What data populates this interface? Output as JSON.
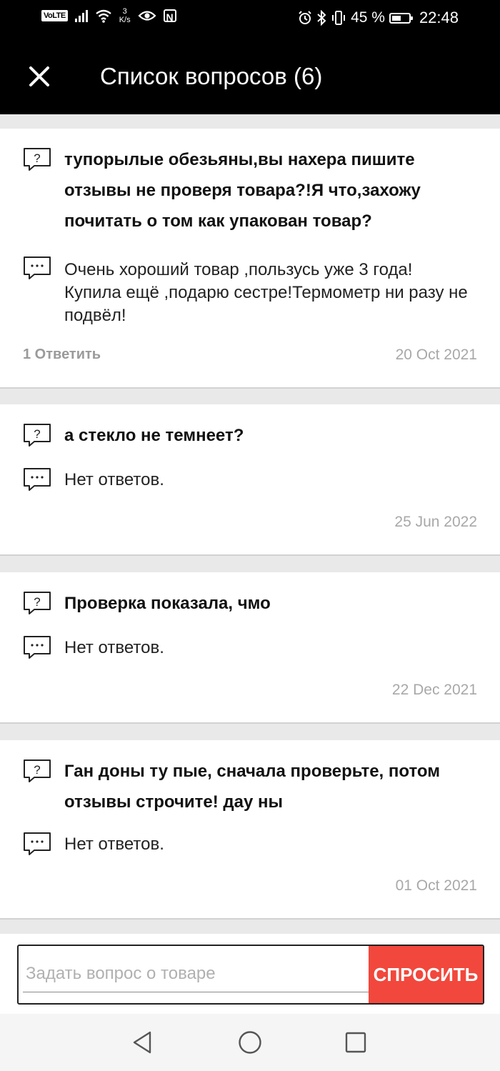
{
  "status_bar": {
    "volte": "VoLTE",
    "speed_value": "3",
    "speed_unit": "K/s",
    "nfc": "N",
    "battery": "45 %",
    "battery_level": 0.45,
    "time": "22:48",
    "icons": [
      "signal-icon",
      "wifi-icon",
      "eye-icon",
      "nfc-icon",
      "alarm-icon",
      "bluetooth-icon",
      "vibrate-icon",
      "battery-icon"
    ]
  },
  "header": {
    "title": "Список вопросов (6)",
    "close_icon": "close-icon"
  },
  "questions": [
    {
      "question": "тупорылые обезьяны,вы нахера пишите отзывы не проверя товара?!Я что,захожу почитать о том как упакован товар?",
      "answer": "Очень хороший товар ,пользусь уже 3 года! Купила ещё ,подарю сестре!Термометр ни разу не подвёл!",
      "reply_label": "1 Ответить",
      "date": "20 Oct 2021"
    },
    {
      "question": "а стекло не темнеет?",
      "answer": "Нет ответов.",
      "date": "25 Jun 2022"
    },
    {
      "question": "Проверка показала, чмо",
      "answer": "Нет ответов.",
      "date": "22 Dec 2021"
    },
    {
      "question": "Ган доны ту пые, сначала проверьте, потом отзывы строчите! дау ны",
      "answer": "Нет ответов.",
      "date": "01 Oct 2021"
    }
  ],
  "ask": {
    "placeholder": "Задать вопрос о товаре",
    "button_label": "СПРОСИТЬ",
    "button_color": "#f2473c"
  },
  "nav": {
    "icons": [
      "back-icon",
      "home-icon",
      "recents-icon"
    ]
  }
}
